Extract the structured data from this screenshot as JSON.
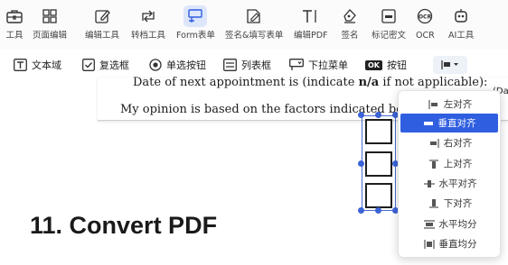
{
  "toolbar": {
    "items": [
      {
        "label": "工具"
      },
      {
        "label": "页面编辑"
      },
      {
        "label": "编辑工具"
      },
      {
        "label": "转档工具"
      },
      {
        "label": "Form表单"
      },
      {
        "label": "签名&填写表单"
      },
      {
        "label": "编辑PDF"
      },
      {
        "label": "签名"
      },
      {
        "label": "标记密文"
      },
      {
        "label": "OCR"
      },
      {
        "label": "AI工具"
      }
    ],
    "active_index": 4
  },
  "form_toolbar": {
    "text_field": "文本域",
    "checkbox": "复选框",
    "radio": "单选按钮",
    "list_box": "列表框",
    "dropdown": "下拉菜单",
    "button_badge": "OK",
    "button": "按钮"
  },
  "document": {
    "line1_a": "Date of next appointment is (indicate ",
    "line1_b": "n/a",
    "line1_c": " if not applicable):",
    "line2": "My opinion is based on the factors indicated below:",
    "right_fragment": "(Da"
  },
  "heading": "11. Convert PDF",
  "align_menu": {
    "items": [
      {
        "label": "左对齐",
        "icon": "align-left-icon"
      },
      {
        "label": "垂直对齐",
        "icon": "align-vertical-center-icon"
      },
      {
        "label": "右对齐",
        "icon": "align-right-icon"
      },
      {
        "label": "上对齐",
        "icon": "align-top-icon"
      },
      {
        "label": "水平对齐",
        "icon": "align-horizontal-center-icon"
      },
      {
        "label": "下对齐",
        "icon": "align-bottom-icon"
      },
      {
        "label": "水平均分",
        "icon": "distribute-horizontal-icon"
      },
      {
        "label": "垂直均分",
        "icon": "distribute-vertical-icon"
      }
    ],
    "selected_index": 1,
    "selected_color": "#2f5fe0"
  },
  "colors": {
    "accent": "#3b63d6",
    "ocr_badge": "#2b2b2b",
    "ok_badge": "#222222"
  }
}
